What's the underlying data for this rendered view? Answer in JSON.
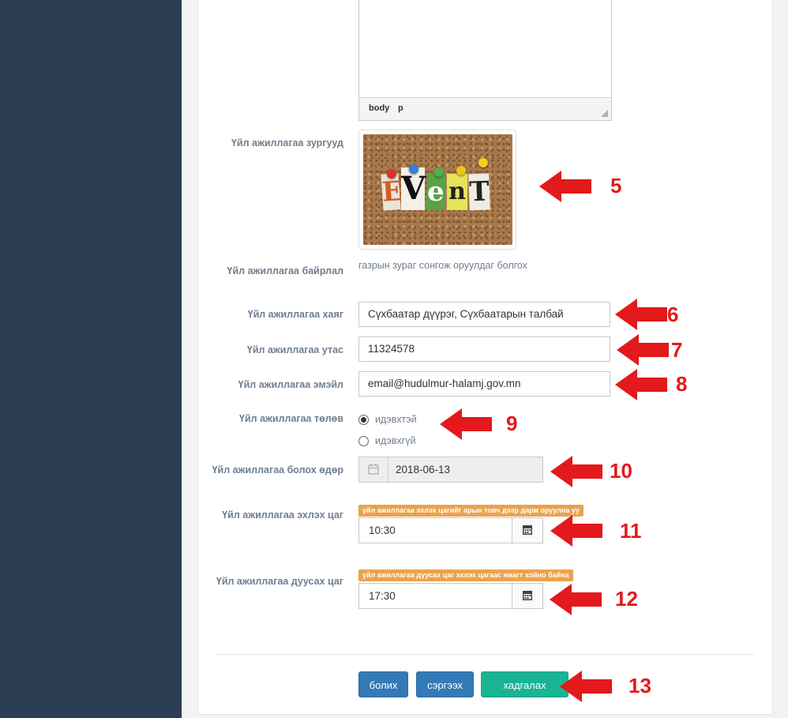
{
  "form": {
    "editor": {
      "path": [
        "body",
        "p"
      ]
    },
    "image_label": "Үйл ажиллагаа зургууд",
    "image_alt_text": "EVenT",
    "location_label": "Үйл ажиллагаа байрлал",
    "location_hint": "газрын зураг сонгож оруулдаг болгох",
    "address_label": "Үйл ажиллагаа хаяг",
    "address_value": "Сүхбаатар дүүрэг, Сүхбаатарын талбай",
    "phone_label": "Үйл ажиллагаа утас",
    "phone_value": "11324578",
    "email_label": "Үйл ажиллагаа эмэйл",
    "email_value": "email@hudulmur-halamj.gov.mn",
    "status_label": "Үйл ажиллагаа төлөв",
    "status_options": [
      "идэвхтэй",
      "идэвхгүй"
    ],
    "status_selected": "идэвхтэй",
    "date_label": "Үйл ажиллагаа болох өдөр",
    "date_value": "2018-06-13",
    "start_label": "Үйл ажиллагаа эхлэх цаг",
    "start_badge": "үйл ажиллагаа эхлэх цагийг арын товч дээр дарж оруулна уу",
    "start_value": "10:30",
    "end_label": "Үйл ажиллагаа дуусах цаг",
    "end_badge": "үйл ажиллагаа дуусах цаг эхлэх цагаас ямагт хойно байна",
    "end_value": "17:30"
  },
  "buttons": {
    "cancel": "болих",
    "restore": "сэргээх",
    "save": "хадгалах"
  },
  "annotations": [
    "5",
    "6",
    "7",
    "8",
    "9",
    "10",
    "11",
    "12",
    "13"
  ],
  "colors": {
    "sidebar": "#2c3e54",
    "primary": "#337ab7",
    "success": "#1ab394",
    "badge": "#e9a34f",
    "annotation": "#e3191b"
  }
}
